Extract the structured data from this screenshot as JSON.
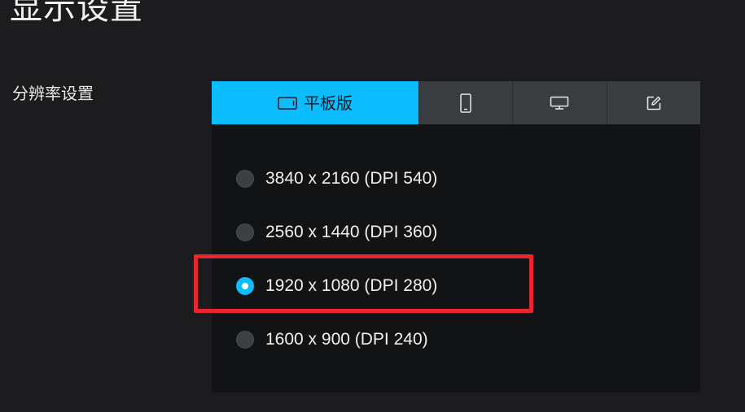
{
  "header": {
    "title": "显示设置"
  },
  "resolution": {
    "section_label": "分辨率设置",
    "tabs": [
      {
        "label": "平板版",
        "icon": "tablet-icon",
        "active": true
      },
      {
        "label": "",
        "icon": "phone-icon",
        "active": false
      },
      {
        "label": "",
        "icon": "monitor-icon",
        "active": false
      },
      {
        "label": "",
        "icon": "edit-icon",
        "active": false
      }
    ],
    "options": [
      {
        "label": "3840 x 2160 (DPI 540)",
        "selected": false
      },
      {
        "label": "2560 x 1440 (DPI 360)",
        "selected": false
      },
      {
        "label": "1920 x 1080 (DPI 280)",
        "selected": true
      },
      {
        "label": "1600 x 900 (DPI 240)",
        "selected": false
      }
    ]
  },
  "colors": {
    "accent": "#0bbcff",
    "highlight": "#e8262d",
    "background": "#1c1c1e",
    "panel": "#121315",
    "tab_inactive": "#3a3d40"
  }
}
